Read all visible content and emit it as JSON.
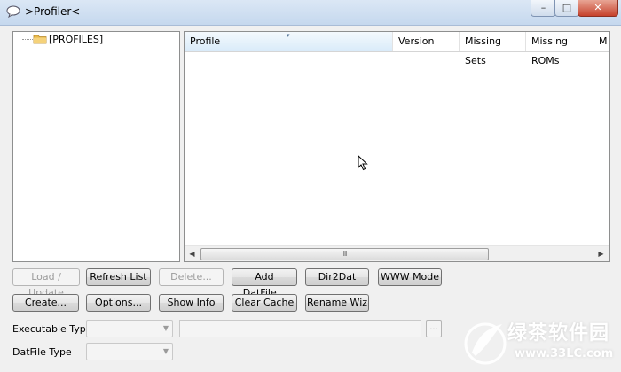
{
  "window": {
    "title": ">Profiler<",
    "controls": {
      "minimize": "–",
      "maximize": "□",
      "close": "✕"
    }
  },
  "tree": {
    "items": [
      {
        "label": "[PROFILES]",
        "icon": "folder-icon"
      }
    ]
  },
  "list": {
    "columns": [
      "Profile",
      "Version",
      "Missing Sets",
      "Missing ROMs",
      "M"
    ],
    "sorted_column": "Profile",
    "rows": [],
    "scroll_grip": "III"
  },
  "buttons": {
    "load_update": "Load / Update",
    "refresh_list": "Refresh List",
    "delete": "Delete...",
    "add_datfile": "Add DatFile...",
    "dir2dat": "Dir2Dat",
    "www_mode": "WWW Mode",
    "create": "Create...",
    "options": "Options...",
    "show_info": "Show Info",
    "clear_cache": "Clear Cache",
    "rename_wiz": "Rename Wiz",
    "browse": "..."
  },
  "fields": {
    "executable_type_label": "Executable Type",
    "executable_type_value": "",
    "executable_path_value": "",
    "datfile_type_label": "DatFile Type",
    "datfile_type_value": ""
  },
  "watermark": {
    "text": "绿茶软件园",
    "url": "www.33LC.com"
  },
  "colors": {
    "accent": "#3c7fb1",
    "close_button": "#c6422c",
    "folder": "#e8b84a"
  }
}
